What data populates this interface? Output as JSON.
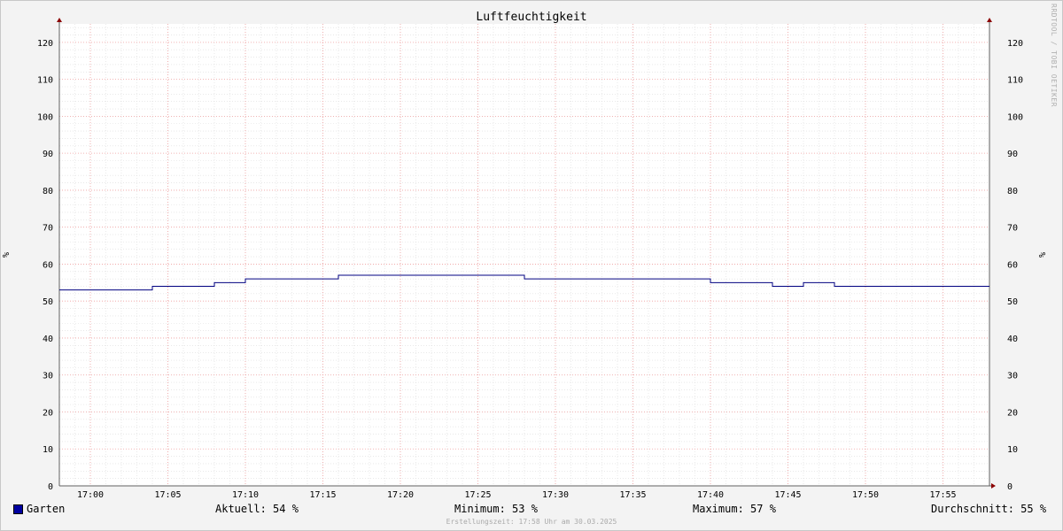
{
  "chart_data": {
    "type": "line",
    "title": "Luftfeuchtigkeit",
    "ylabel": "%",
    "ylim": [
      0,
      125
    ],
    "yticks": [
      0,
      10,
      20,
      30,
      40,
      50,
      60,
      70,
      80,
      90,
      100,
      110,
      120
    ],
    "xlim_minutes": [
      -2,
      58
    ],
    "xticks": [
      "17:00",
      "17:05",
      "17:10",
      "17:15",
      "17:20",
      "17:25",
      "17:30",
      "17:35",
      "17:40",
      "17:45",
      "17:50",
      "17:55"
    ],
    "grid": true,
    "series": [
      {
        "name": "Garten",
        "color": "#000080",
        "step": true,
        "x": [
          "16:58",
          "17:04",
          "17:08",
          "17:10",
          "17:16",
          "17:28",
          "17:40",
          "17:44",
          "17:46",
          "17:48",
          "17:58"
        ],
        "values": [
          53,
          54,
          55,
          56,
          57,
          56,
          55,
          54,
          55,
          54,
          54
        ]
      }
    ]
  },
  "legend": {
    "series_name": "Garten",
    "series_color": "#000080",
    "current": "Aktuell:  54 %",
    "minimum": "Minimum:  53 %",
    "maximum": "Maximum:  57 %",
    "average": "Durchschnitt:  55 %"
  },
  "footer": "Erstellungszeit: 17:58 Uhr am 30.03.2025",
  "watermark": "RRDTOOL / TOBI OETIKER"
}
